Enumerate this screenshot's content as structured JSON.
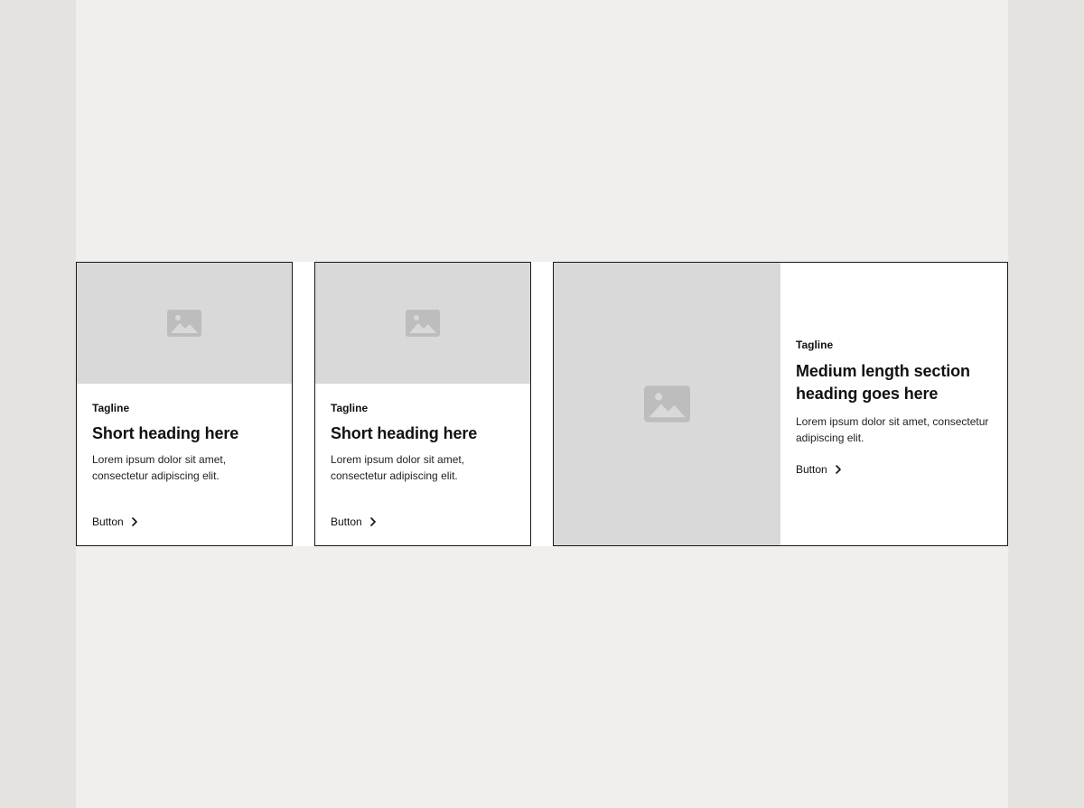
{
  "cards": [
    {
      "tagline": "Tagline",
      "heading": "Short heading here",
      "body": "Lorem ipsum dolor sit amet, consectetur adipiscing elit.",
      "button_label": "Button",
      "image_icon": "image-placeholder-icon",
      "button_icon": "chevron-right-icon"
    },
    {
      "tagline": "Tagline",
      "heading": "Short heading here",
      "body": "Lorem ipsum dolor sit amet, consectetur adipiscing elit.",
      "button_label": "Button",
      "image_icon": "image-placeholder-icon",
      "button_icon": "chevron-right-icon"
    },
    {
      "tagline": "Tagline",
      "heading": "Medium length section heading goes here",
      "body": "Lorem ipsum dolor sit amet, consectetur adipiscing elit.",
      "button_label": "Button",
      "image_icon": "image-placeholder-icon",
      "button_icon": "chevron-right-icon"
    }
  ],
  "colors": {
    "outer_background": "#e4e3df",
    "canvas_background": "#f0efed",
    "card_background": "#ffffff",
    "image_placeholder": "#d9d9d9",
    "image_icon": "#bdbdbd",
    "border": "#1a1a1a",
    "text": "#111111"
  }
}
